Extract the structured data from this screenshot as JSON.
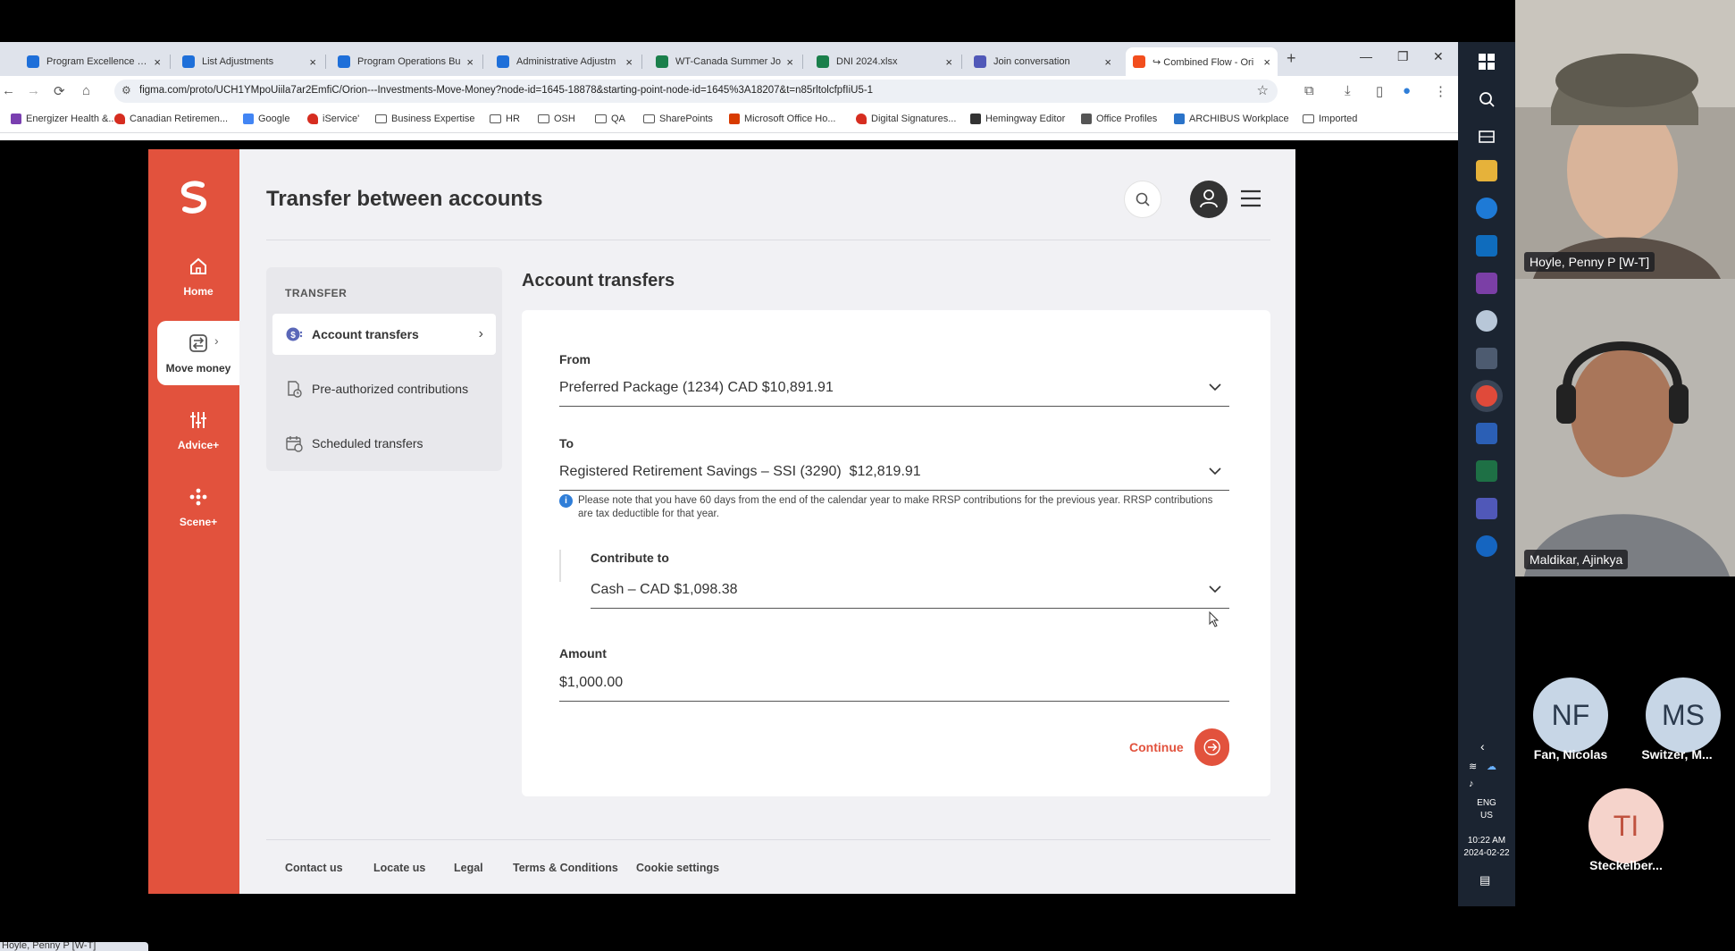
{
  "browser": {
    "tabs": [
      {
        "title": "Program Excellence - E",
        "color": "#1e6fd9"
      },
      {
        "title": "List Adjustments",
        "color": "#1e6fd9"
      },
      {
        "title": "Program Operations Bu",
        "color": "#1e6fd9"
      },
      {
        "title": "Administrative Adjustm",
        "color": "#1e6fd9"
      },
      {
        "title": "WT-Canada Summer Jo",
        "color": "#1a7f4b"
      },
      {
        "title": "DNI 2024.xlsx",
        "color": "#1a7f4b"
      },
      {
        "title": "Join conversation",
        "color": "#5058b8"
      },
      {
        "title": "↪ Combined Flow - Ori",
        "color": "#f24e1e"
      }
    ],
    "new_tab": "+",
    "url": "figma.com/proto/UCH1YMpoUiila7ar2EmfiC/Orion---Investments-Move-Money?node-id=1645-18878&starting-point-node-id=1645%3A18207&t=n85rltolcfpfIiU5-1",
    "bookmarks": [
      {
        "label": "Energizer Health &...",
        "type": "site",
        "color": "#7a3fb0"
      },
      {
        "label": "Canadian Retiremen...",
        "type": "leaf",
        "color": "#d62d20"
      },
      {
        "label": "Google",
        "type": "site",
        "color": "#4285f4"
      },
      {
        "label": "iService'",
        "type": "leaf",
        "color": "#d62d20"
      },
      {
        "label": "Business Expertise",
        "type": "folder"
      },
      {
        "label": "HR",
        "type": "folder"
      },
      {
        "label": "OSH",
        "type": "folder"
      },
      {
        "label": "QA",
        "type": "folder"
      },
      {
        "label": "SharePoints",
        "type": "folder"
      },
      {
        "label": "Microsoft Office Ho...",
        "type": "site",
        "color": "#d83b01"
      },
      {
        "label": "Digital Signatures...",
        "type": "leaf",
        "color": "#d62d20"
      },
      {
        "label": "Hemingway Editor",
        "type": "site",
        "color": "#333333"
      },
      {
        "label": "Office Profiles",
        "type": "site",
        "color": "#555555"
      },
      {
        "label": "ARCHIBUS Workplace",
        "type": "site",
        "color": "#2a73c9"
      },
      {
        "label": "Imported",
        "type": "folder"
      }
    ]
  },
  "app": {
    "brand_color": "#e2523d",
    "rail": [
      {
        "label": "Home",
        "icon": "home-icon"
      },
      {
        "label": "Move money",
        "icon": "transfer-icon"
      },
      {
        "label": "Advice+",
        "icon": "sliders-icon"
      },
      {
        "label": "Scene+",
        "icon": "scene-icon"
      }
    ],
    "page_title": "Transfer between accounts",
    "subnav": {
      "heading": "TRANSFER",
      "items": [
        {
          "label": "Account transfers"
        },
        {
          "label": "Pre-authorized contributions"
        },
        {
          "label": "Scheduled transfers"
        }
      ]
    },
    "section_title": "Account transfers",
    "form": {
      "from_label": "From",
      "from_value": "Preferred Package (1234) CAD $10,891.91",
      "to_label": "To",
      "to_value": "Registered Retirement Savings – SSI (3290)  $12,819.91",
      "info_icon": "i",
      "info_text": "Please note that you have 60 days from the end of the calendar year to make RRSP contributions for the previous year. RRSP contributions are tax deductible for that year.",
      "contribute_label": "Contribute to",
      "contribute_value": "Cash – CAD $1,098.38",
      "amount_label": "Amount",
      "amount_value": "$1,000.00",
      "continue_label": "Continue"
    },
    "footer": [
      "Contact us",
      "Locate us",
      "Legal",
      "Terms & Conditions",
      "Cookie settings"
    ]
  },
  "taskbar": {
    "lang_1": "ENG",
    "lang_2": "US",
    "time": "10:22 AM",
    "date": "2024-02-22"
  },
  "call": {
    "video_1_name": "Hoyle, Penny P [W-T]",
    "video_2_name": "Maldikar, Ajinkya",
    "participants": [
      {
        "initials": "NF",
        "name": "Fan, Nicolas",
        "color": "#c7d6e6"
      },
      {
        "initials": "MS",
        "name": "Switzer, M...",
        "color": "#c7d6e6"
      },
      {
        "initials": "TI",
        "name": "Steckelber...",
        "color": "#f5d3cb"
      }
    ],
    "self_tag": "Hoyle, Penny P [W-T]"
  }
}
